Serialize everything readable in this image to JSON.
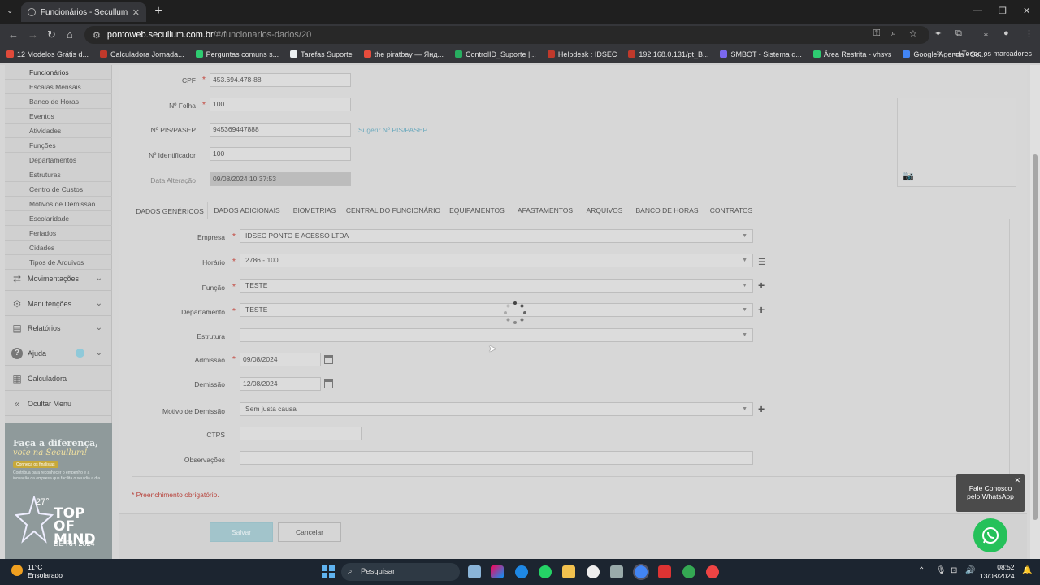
{
  "browser": {
    "tab_title": "Funcionários - Secullum Ponto W",
    "url_host": "pontoweb.secullum.com.br",
    "url_path": "/#/funcionarios-dados/20",
    "bookmarks": [
      {
        "label": "12 Modelos Grátis d...",
        "color": "#e04a3a"
      },
      {
        "label": "Calculadora Jornada...",
        "color": "#c0392b"
      },
      {
        "label": "Perguntas comuns s...",
        "color": "#2ecc71"
      },
      {
        "label": "Tarefas Suporte",
        "color": "#ecf0f1"
      },
      {
        "label": "the piratbay — Янд...",
        "color": "#e74c3c"
      },
      {
        "label": "ControlID_Suporte |...",
        "color": "#27ae60"
      },
      {
        "label": "Helpdesk : IDSEC",
        "color": "#c0392b"
      },
      {
        "label": "192.168.0.131/pt_B...",
        "color": "#c0392b"
      },
      {
        "label": "SMBOT - Sistema d...",
        "color": "#7b68ee"
      },
      {
        "label": "Área Restrita - vhsys",
        "color": "#2ecc71"
      },
      {
        "label": "Google Agenda - Se...",
        "color": "#4285f4"
      }
    ],
    "all_bookmarks": "Todos os marcadores"
  },
  "sidebar": {
    "submenu": [
      "Funcionários",
      "Escalas Mensais",
      "Banco de Horas",
      "Eventos",
      "Atividades",
      "Funções",
      "Departamentos",
      "Estruturas",
      "Centro de Custos",
      "Motivos de Demissão",
      "Escolaridade",
      "Feriados",
      "Cidades",
      "Tipos de Arquivos"
    ],
    "menus": [
      {
        "label": "Movimentações",
        "icon": "swap-icon"
      },
      {
        "label": "Manutenções",
        "icon": "gear-icon"
      },
      {
        "label": "Relatórios",
        "icon": "report-icon"
      },
      {
        "label": "Ajuda",
        "icon": "help-icon",
        "badge": "!"
      },
      {
        "label": "Calculadora",
        "icon": "calculator-icon"
      },
      {
        "label": "Ocultar Menu",
        "icon": "collapse-icon"
      }
    ],
    "banner": {
      "line1": "Faça a diferença,",
      "line2": "vote na Secullum!",
      "pill": "Conheça os finalistas",
      "small": "Contribua para reconhecer o empenho e a inovação da empresa que facilita o seu dia a dia.",
      "num": "27°",
      "top1": "TOP",
      "top2": "OF MIND",
      "rh": "DE RH 2024"
    }
  },
  "form_top": {
    "cpf_label": "CPF",
    "cpf": "453.694.478-88",
    "folha_label": "Nº Folha",
    "folha": "100",
    "pis_label": "Nº PIS/PASEP",
    "pis": "945369447888",
    "pis_suggest": "Sugerir Nº PIS/PASEP",
    "ident_label": "Nº Identificador",
    "ident": "100",
    "alter_label": "Data Alteração",
    "alter": "09/08/2024 10:37:53"
  },
  "tabs": [
    "DADOS GENÉRICOS",
    "DADOS ADICIONAIS",
    "BIOMETRIAS",
    "CENTRAL DO FUNCIONÁRIO",
    "EQUIPAMENTOS",
    "AFASTAMENTOS",
    "ARQUIVOS",
    "BANCO DE HORAS",
    "CONTRATOS"
  ],
  "generic": {
    "empresa_label": "Empresa",
    "empresa": "IDSEC PONTO E ACESSO LTDA",
    "horario_label": "Horário",
    "horario": "2786 - 100",
    "funcao_label": "Função",
    "funcao": "TESTE",
    "depto_label": "Departamento",
    "depto": "TESTE",
    "estrutura_label": "Estrutura",
    "estrutura": "",
    "admissao_label": "Admissão",
    "admissao": "09/08/2024",
    "demissao_label": "Demissão",
    "demissao": "12/08/2024",
    "motivo_label": "Motivo de Demissão",
    "motivo": "Sem justa causa",
    "ctps_label": "CTPS",
    "ctps": "",
    "obs_label": "Observações",
    "obs": ""
  },
  "required_note": "* Preenchimento obrigatório.",
  "buttons": {
    "save": "Salvar",
    "cancel": "Cancelar"
  },
  "whatsapp": {
    "line1": "Fale Conosco",
    "line2": "pelo WhatsApp"
  },
  "taskbar": {
    "temp": "11°C",
    "weather": "Ensolarado",
    "search": "Pesquisar",
    "time": "08:52",
    "date": "13/08/2024"
  }
}
